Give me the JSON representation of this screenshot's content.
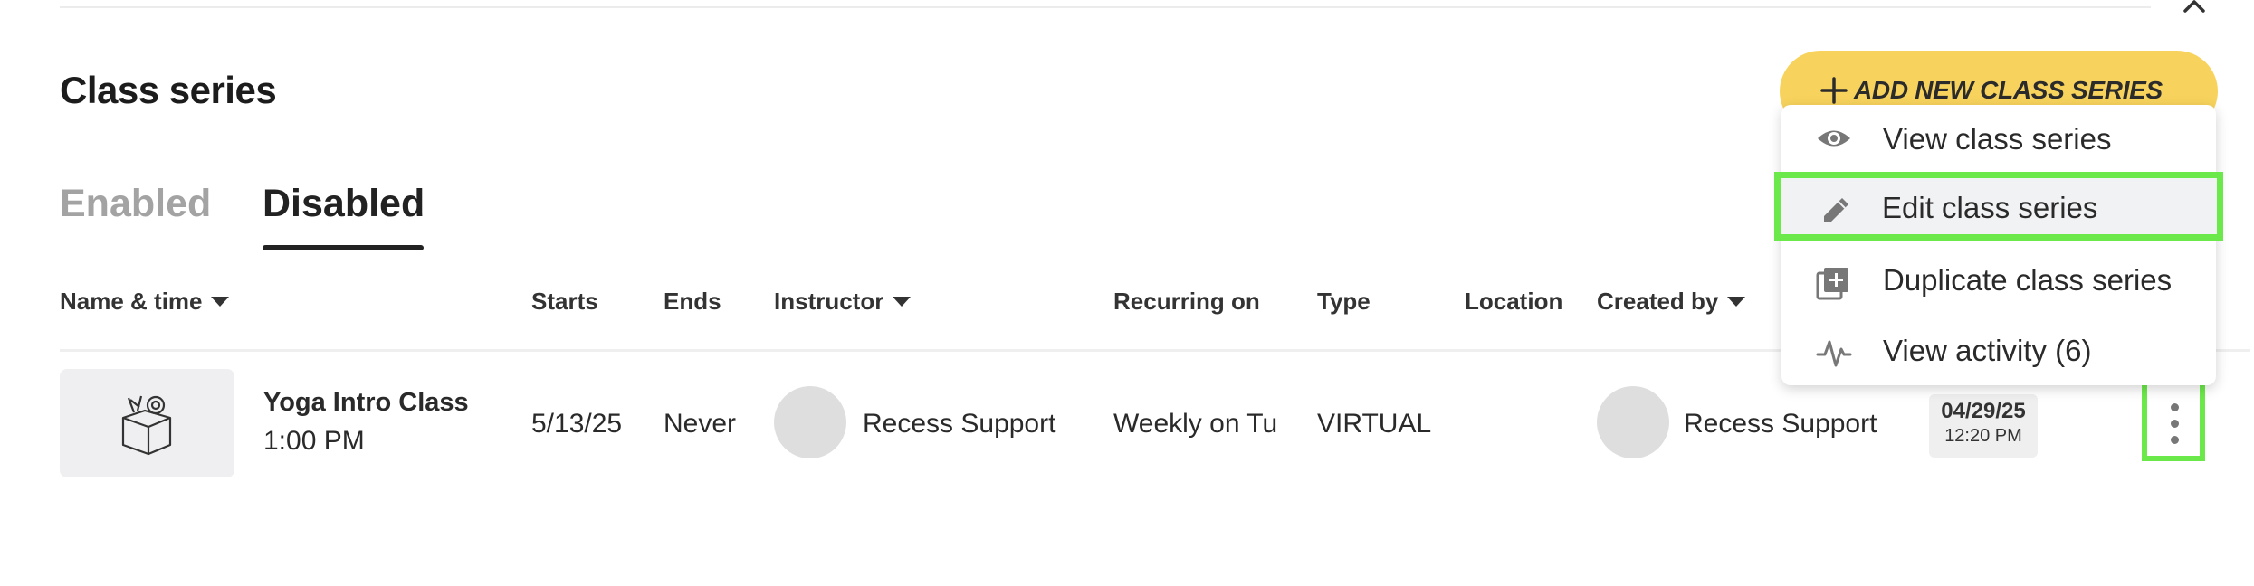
{
  "page": {
    "title": "Class series"
  },
  "tabs": [
    {
      "label": "Enabled",
      "active": false
    },
    {
      "label": "Disabled",
      "active": true
    }
  ],
  "table": {
    "headers": {
      "name_time": "Name & time",
      "starts": "Starts",
      "ends": "Ends",
      "instructor": "Instructor",
      "recurring_on": "Recurring on",
      "type": "Type",
      "location": "Location",
      "created_by": "Created by"
    },
    "rows": [
      {
        "name": "Yoga Intro Class",
        "time": "1:00 PM",
        "starts": "5/13/25",
        "ends": "Never",
        "instructor": "Recess Support",
        "recurring_on": "Weekly on Tu",
        "type": "VIRTUAL",
        "location": "",
        "created_by": "Recess Support",
        "created_date": "04/29/25",
        "created_time": "12:20 PM"
      }
    ]
  },
  "add_button": {
    "label": "ADD NEW CLASS SERIES",
    "color": "#f7d35d"
  },
  "menu": {
    "items": [
      {
        "label": "View class series",
        "icon": "eye-icon"
      },
      {
        "label": "Edit class series",
        "icon": "pencil-icon",
        "highlighted": true
      },
      {
        "label": "Duplicate class series",
        "icon": "duplicate-icon"
      },
      {
        "label": "View activity (6)",
        "icon": "activity-icon"
      }
    ]
  },
  "colors": {
    "highlight": "#6ce94a",
    "accent": "#f7d35d",
    "muted_tab": "#a3a3a3"
  }
}
